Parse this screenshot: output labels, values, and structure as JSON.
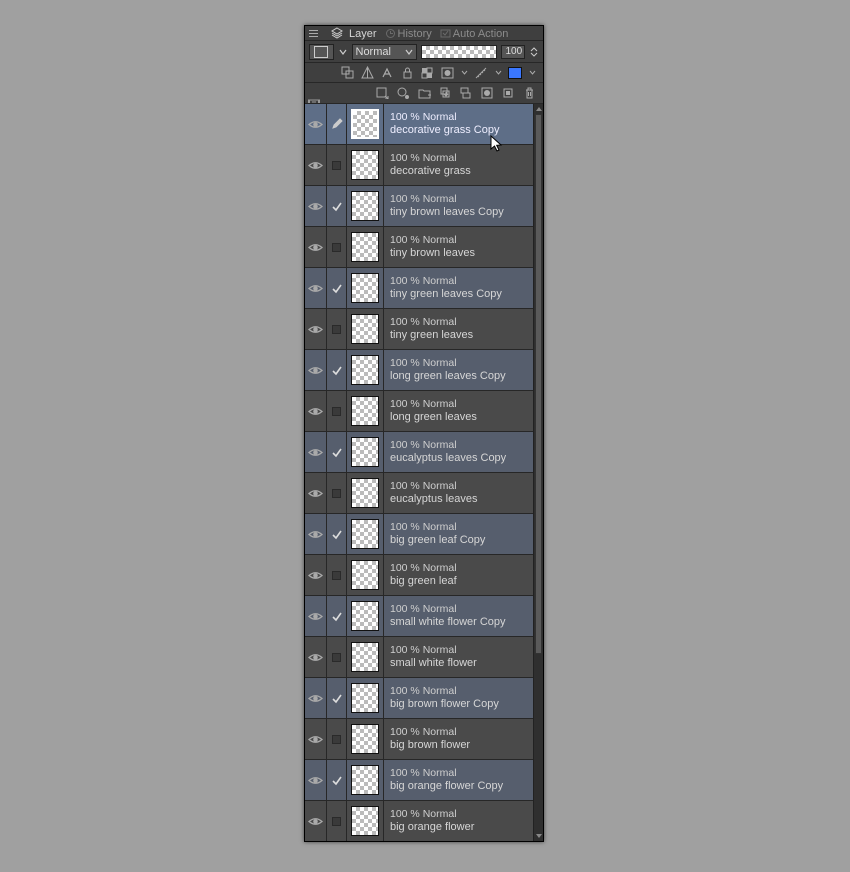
{
  "tabs": {
    "layer": "Layer",
    "history": "History",
    "auto_action": "Auto Action"
  },
  "blend": {
    "mode": "Normal",
    "opacity": "100"
  },
  "layers": [
    {
      "opacity": "100 % Normal",
      "name": "decorative grass Copy",
      "sel": "A",
      "check": "pencil",
      "thumbActive": true
    },
    {
      "opacity": "100 % Normal",
      "name": "decorative grass",
      "sel": "",
      "check": "box"
    },
    {
      "opacity": "100 % Normal",
      "name": "tiny brown leaves Copy",
      "sel": "B",
      "check": "check"
    },
    {
      "opacity": "100 % Normal",
      "name": "tiny brown leaves",
      "sel": "",
      "check": "box"
    },
    {
      "opacity": "100 % Normal",
      "name": "tiny green leaves Copy",
      "sel": "B",
      "check": "check"
    },
    {
      "opacity": "100 % Normal",
      "name": "tiny green leaves",
      "sel": "",
      "check": "box"
    },
    {
      "opacity": "100 % Normal",
      "name": "long green leaves Copy",
      "sel": "B",
      "check": "check"
    },
    {
      "opacity": "100 % Normal",
      "name": "long green leaves",
      "sel": "",
      "check": "box"
    },
    {
      "opacity": "100 % Normal",
      "name": "eucalyptus leaves Copy",
      "sel": "B",
      "check": "check"
    },
    {
      "opacity": "100 % Normal",
      "name": "eucalyptus leaves",
      "sel": "",
      "check": "box"
    },
    {
      "opacity": "100 % Normal",
      "name": "big green leaf Copy",
      "sel": "B",
      "check": "check"
    },
    {
      "opacity": "100 % Normal",
      "name": "big green leaf",
      "sel": "",
      "check": "box"
    },
    {
      "opacity": "100 % Normal",
      "name": "small white flower Copy",
      "sel": "B",
      "check": "check"
    },
    {
      "opacity": "100 % Normal",
      "name": "small white flower",
      "sel": "",
      "check": "box"
    },
    {
      "opacity": "100 % Normal",
      "name": "big brown flower Copy",
      "sel": "B",
      "check": "check"
    },
    {
      "opacity": "100 % Normal",
      "name": "big brown flower",
      "sel": "",
      "check": "box"
    },
    {
      "opacity": "100 % Normal",
      "name": "big orange flower Copy",
      "sel": "B",
      "check": "check"
    },
    {
      "opacity": "100 % Normal",
      "name": "big orange flower",
      "sel": "",
      "check": "box"
    }
  ]
}
